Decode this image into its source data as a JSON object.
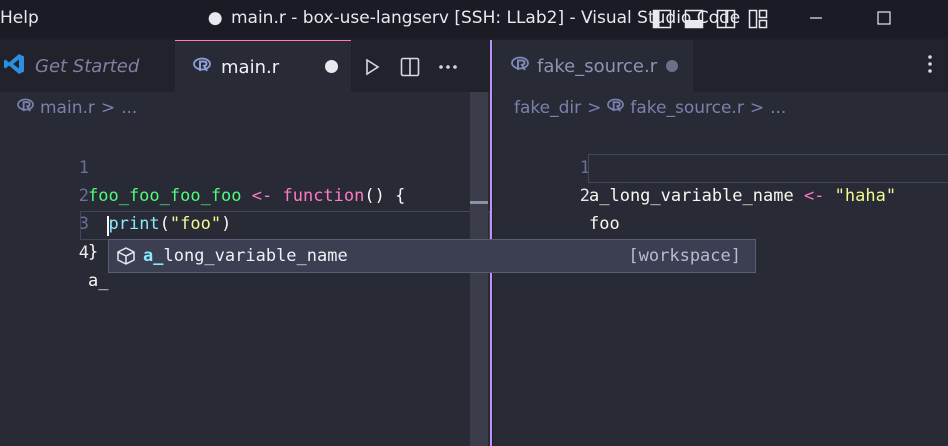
{
  "window": {
    "menu_help": "Help",
    "title_dot": "●",
    "title": "main.r - box-use-langserv [SSH: LLab2] - Visual Studio Code"
  },
  "left_editor": {
    "tabs": {
      "get_started": "Get Started",
      "main": "main.r"
    },
    "breadcrumb": {
      "file": "main.r",
      "sep": ">",
      "more": "..."
    },
    "lines": [
      {
        "n": "1",
        "name": "foo_foo_foo_foo",
        "assign": " <- ",
        "kw": "function",
        "rest": "() {"
      },
      {
        "n": "2",
        "indent": "  ",
        "call": "print",
        "open": "(",
        "str": "\"foo\"",
        "close": ")"
      },
      {
        "n": "3",
        "text": "}"
      },
      {
        "n": "4",
        "text": "a_"
      }
    ]
  },
  "right_editor": {
    "tab": "fake_source.r",
    "breadcrumb": {
      "dir": "fake_dir",
      "sep": ">",
      "file": "fake_source.r",
      "more": "..."
    },
    "lines": [
      {
        "n": "1",
        "name": "a_long_variable_name",
        "assign": " <- ",
        "str": "\"haha\""
      },
      {
        "n": "2",
        "text": "foo"
      }
    ]
  },
  "suggest": {
    "match": "a_",
    "rest": "long_variable_name",
    "detail": "[workspace]"
  },
  "colors": {
    "accent": "#bd93f9",
    "tab_active_border": "#ff79c6",
    "editor_bg": "#282a36"
  },
  "icons": [
    "vscode-logo-icon",
    "r-file-icon",
    "run-icon",
    "split-editor-icon",
    "more-actions-icon",
    "symbol-variable-icon"
  ]
}
